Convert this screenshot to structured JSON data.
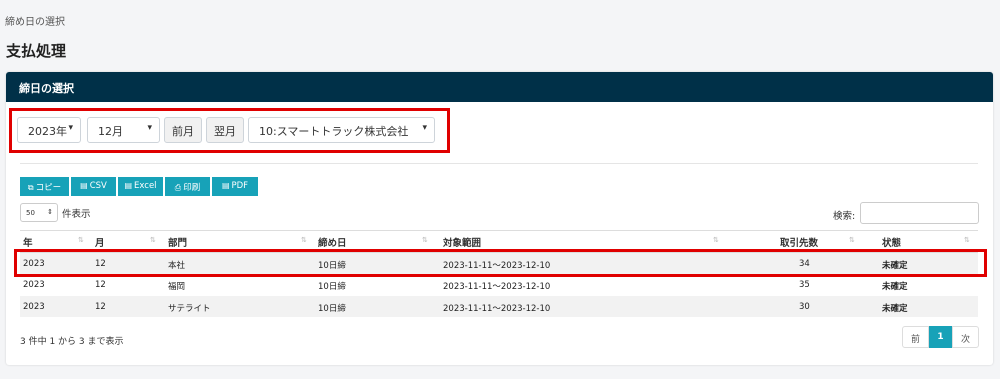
{
  "breadcrumb": "締め日の選択",
  "page_title": "支払処理",
  "card": {
    "header": "締日の選択"
  },
  "filters": {
    "year": "2023年",
    "month": "12月",
    "prev_month": "前月",
    "next_month": "翌月",
    "company": "10:スマートトラック株式会社"
  },
  "export_buttons": [
    {
      "label": "コピー",
      "icon": "copy-icon"
    },
    {
      "label": "CSV",
      "icon": "file-icon"
    },
    {
      "label": "Excel",
      "icon": "excel-icon"
    },
    {
      "label": "印刷",
      "icon": "print-icon"
    },
    {
      "label": "PDF",
      "icon": "file-icon"
    }
  ],
  "length": {
    "value": "50",
    "label": "件表示"
  },
  "search": {
    "label": "検索:",
    "value": ""
  },
  "table": {
    "headers": [
      "年",
      "月",
      "部門",
      "締め日",
      "対象範囲",
      "取引先数",
      "状態"
    ],
    "rows": [
      [
        "2023",
        "12",
        "本社",
        "10日締",
        "2023-11-11～2023-12-10",
        "34",
        "未確定"
      ],
      [
        "2023",
        "12",
        "福岡",
        "10日締",
        "2023-11-11～2023-12-10",
        "35",
        "未確定"
      ],
      [
        "2023",
        "12",
        "サテライト",
        "10日締",
        "2023-11-11～2023-12-10",
        "30",
        "未確定"
      ]
    ]
  },
  "info": "3 件中 1 から 3 まで表示",
  "pagination": {
    "prev": "前",
    "current": "1",
    "next": "次"
  },
  "colors": {
    "header_bg": "#003048",
    "accent": "#17a2b8",
    "highlight": "#e00000"
  }
}
